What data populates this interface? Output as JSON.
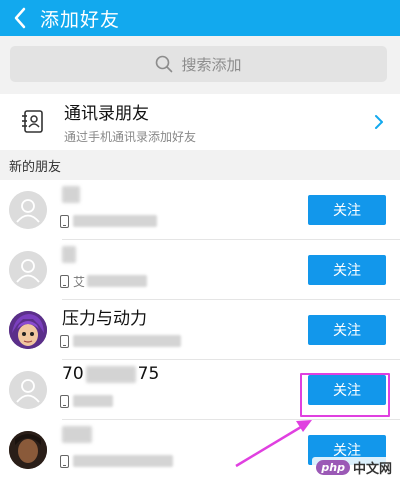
{
  "header": {
    "title": "添加好友"
  },
  "search": {
    "placeholder": "搜索添加"
  },
  "contacts_entry": {
    "title": "通讯录朋友",
    "subtitle": "通过手机通讯录添加好友"
  },
  "section": {
    "title": "新的朋友"
  },
  "friends": [
    {
      "name": "",
      "detail": "",
      "button": "关注",
      "avatar": "default"
    },
    {
      "name": "",
      "detail": "艾",
      "button": "关注",
      "avatar": "default"
    },
    {
      "name": "压力与动力",
      "detail": "",
      "button": "关注",
      "avatar": "anime-character"
    },
    {
      "name_prefix": "70",
      "name_suffix": "75",
      "detail": "",
      "button": "关注",
      "avatar": "default"
    },
    {
      "name": "",
      "detail": "",
      "button": "关注",
      "avatar": "photo"
    }
  ],
  "watermark": {
    "logo": "php",
    "text": "中文网"
  },
  "colors": {
    "header": "#12a9ee",
    "button": "#1297eb",
    "annotation": "#e040e0"
  }
}
